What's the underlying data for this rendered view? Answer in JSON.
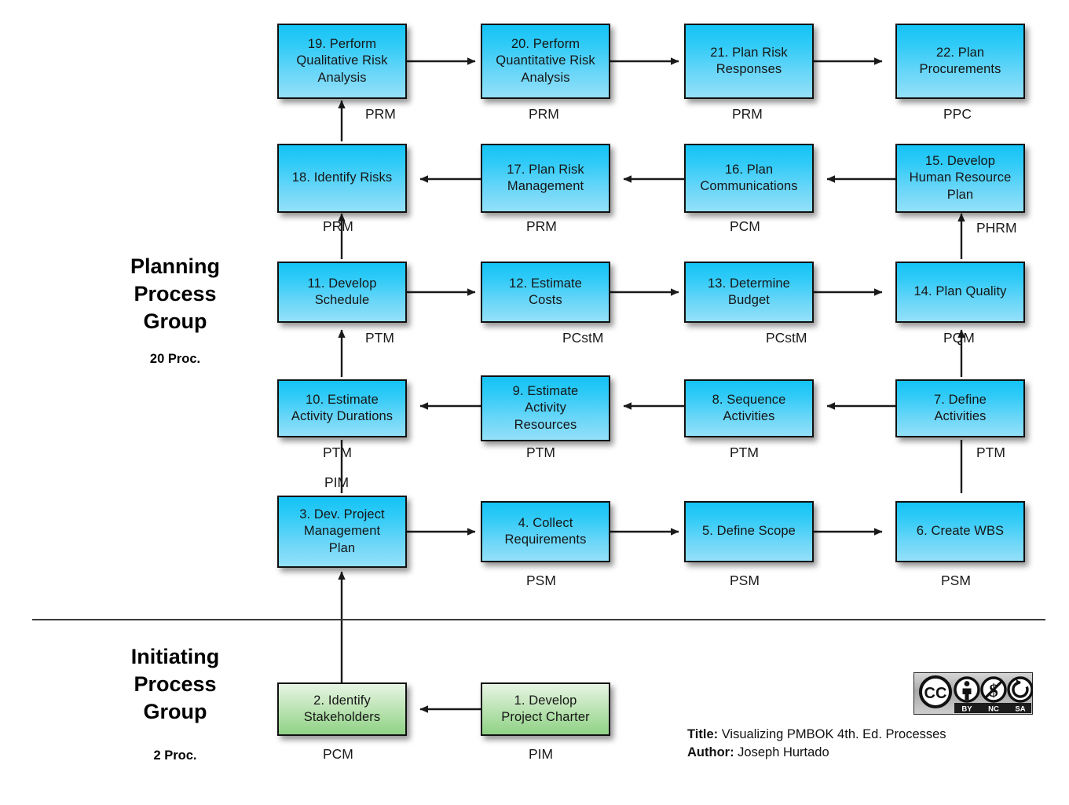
{
  "document": {
    "title": "Visualizing PMBOK 4th. Ed. Processes",
    "author": "Joseph Hurtado",
    "title_label": "Title:",
    "author_label": "Author:"
  },
  "colors": {
    "box_blue_top": "#14c3f6",
    "box_blue_bottom": "#94e0f9",
    "box_green_top": "#e7f5e4",
    "box_green_bottom": "#8fd285",
    "border": "#111111",
    "arrow": "#1a1a1a",
    "text": "#161616"
  },
  "groups": [
    {
      "id": "planning",
      "title_lines": [
        "Planning",
        "Process",
        "Group"
      ],
      "count": "20 Proc."
    },
    {
      "id": "initiating",
      "title_lines": [
        "Initiating",
        "Process",
        "Group"
      ],
      "count": "2 Proc."
    }
  ],
  "processes": [
    {
      "num": 1,
      "label": "1. Develop\nProject Charter",
      "ka": "PIM",
      "group": "initiating"
    },
    {
      "num": 2,
      "label": "2. Identify\nStakeholders",
      "ka": "PCM",
      "group": "initiating"
    },
    {
      "num": 3,
      "label": "3. Dev. Project\nManagement\nPlan",
      "ka": "PIM",
      "group": "planning"
    },
    {
      "num": 4,
      "label": "4. Collect\nRequirements",
      "ka": "PSM",
      "group": "planning"
    },
    {
      "num": 5,
      "label": "5. Define Scope",
      "ka": "PSM",
      "group": "planning"
    },
    {
      "num": 6,
      "label": "6. Create WBS",
      "ka": "PSM",
      "group": "planning"
    },
    {
      "num": 7,
      "label": "7. Define\nActivities",
      "ka": "PTM",
      "group": "planning"
    },
    {
      "num": 8,
      "label": "8. Sequence\nActivities",
      "ka": "PTM",
      "group": "planning"
    },
    {
      "num": 9,
      "label": "9. Estimate\nActivity\nResources",
      "ka": "PTM",
      "group": "planning"
    },
    {
      "num": 10,
      "label": "10. Estimate\nActivity Durations",
      "ka": "PTM",
      "group": "planning"
    },
    {
      "num": 11,
      "label": "11. Develop\nSchedule",
      "ka": "PTM",
      "group": "planning"
    },
    {
      "num": 12,
      "label": "12. Estimate\nCosts",
      "ka": "PCstM",
      "group": "planning"
    },
    {
      "num": 13,
      "label": "13. Determine\nBudget",
      "ka": "PCstM",
      "group": "planning"
    },
    {
      "num": 14,
      "label": "14. Plan Quality",
      "ka": "PQM",
      "group": "planning"
    },
    {
      "num": 15,
      "label": "15. Develop\nHuman Resource\nPlan",
      "ka": "PHRM",
      "group": "planning"
    },
    {
      "num": 16,
      "label": "16. Plan\nCommunications",
      "ka": "PCM",
      "group": "planning"
    },
    {
      "num": 17,
      "label": "17. Plan Risk\nManagement",
      "ka": "PRM",
      "group": "planning"
    },
    {
      "num": 18,
      "label": "18. Identify Risks",
      "ka": "PRM",
      "group": "planning"
    },
    {
      "num": 19,
      "label": "19. Perform\nQualitative Risk\nAnalysis",
      "ka": "PRM",
      "group": "planning"
    },
    {
      "num": 20,
      "label": "20. Perform\nQuantitative Risk\nAnalysis",
      "ka": "PRM",
      "group": "planning"
    },
    {
      "num": 21,
      "label": "21. Plan Risk\nResponses",
      "ka": "PRM",
      "group": "planning"
    },
    {
      "num": 22,
      "label": "22. Plan\nProcurements",
      "ka": "PPC",
      "group": "planning"
    }
  ],
  "license": {
    "name": "cc-by-nc-sa-badge",
    "mark": "CC",
    "terms": [
      "BY",
      "NC",
      "SA"
    ]
  }
}
